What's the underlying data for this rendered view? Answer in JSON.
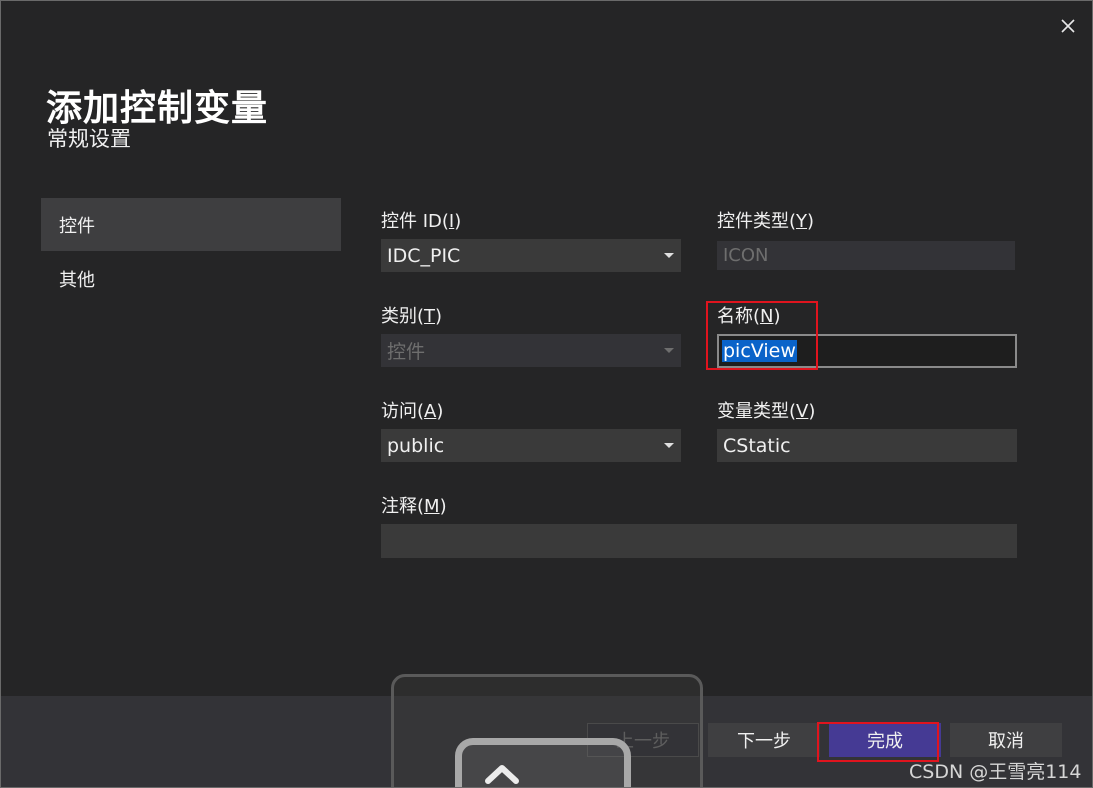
{
  "dialog": {
    "title": "添加控制变量",
    "subtitle": "常规设置",
    "close_icon": "close-icon"
  },
  "nav": {
    "items": [
      {
        "label": "控件",
        "active": true
      },
      {
        "label": "其他",
        "active": false
      }
    ]
  },
  "form": {
    "control_id": {
      "label": "控件 ID",
      "mnemonic": "I",
      "value": "IDC_PIC"
    },
    "control_type": {
      "label": "控件类型",
      "mnemonic": "Y",
      "value": "ICON"
    },
    "category": {
      "label": "类别",
      "mnemonic": "T",
      "value": "控件"
    },
    "name": {
      "label": "名称",
      "mnemonic": "N",
      "value": "picView"
    },
    "access": {
      "label": "访问",
      "mnemonic": "A",
      "value": "public"
    },
    "variable_type": {
      "label": "变量类型",
      "mnemonic": "V",
      "value": "CStatic"
    },
    "comment": {
      "label": "注释",
      "mnemonic": "M",
      "value": ""
    }
  },
  "footer": {
    "prev_label": "上一步",
    "next_label": "下一步",
    "finish_label": "完成",
    "cancel_label": "取消"
  },
  "watermark": "CSDN @王雪亮114",
  "colors": {
    "accent": "#453a94",
    "selection": "#0a63c9",
    "highlight_box": "#e0141e",
    "background": "#252526"
  }
}
